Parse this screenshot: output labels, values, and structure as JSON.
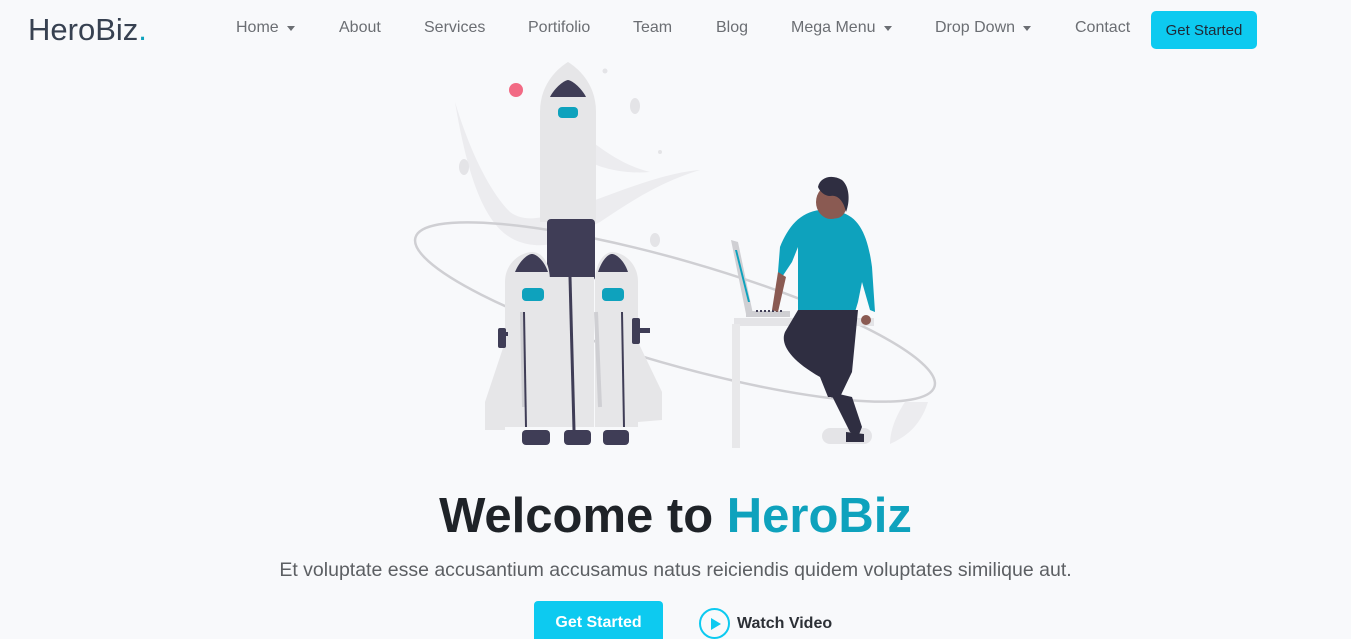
{
  "header": {
    "logo_text": "HeroBiz",
    "logo_dot": ".",
    "nav": [
      {
        "label": "Home",
        "dropdown": true
      },
      {
        "label": "About",
        "dropdown": false
      },
      {
        "label": "Services",
        "dropdown": false
      },
      {
        "label": "Portifolio",
        "dropdown": false
      },
      {
        "label": "Team",
        "dropdown": false
      },
      {
        "label": "Blog",
        "dropdown": false
      },
      {
        "label": "Mega Menu",
        "dropdown": true
      },
      {
        "label": "Drop Down",
        "dropdown": true
      },
      {
        "label": "Contact",
        "dropdown": false
      }
    ],
    "cta_label": "Get Started"
  },
  "hero": {
    "title_prefix": "Welcome to ",
    "title_accent": "HeroBiz",
    "subtitle": "Et voluptate esse accusantium accusamus natus reiciendis quidem voluptates similique aut.",
    "primary_button": "Get Started",
    "video_label": "Watch Video"
  },
  "colors": {
    "accent": "#0ea2bd",
    "button": "#0dcaf0",
    "background": "#f8f9fb"
  }
}
